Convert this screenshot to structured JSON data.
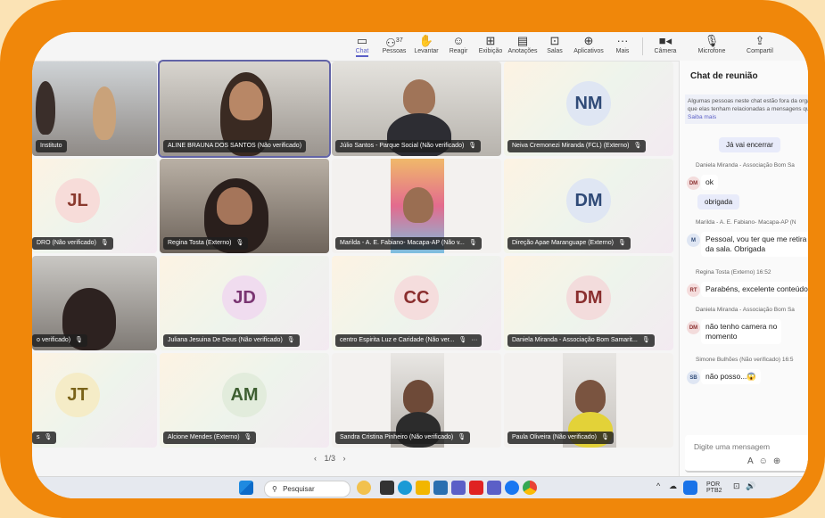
{
  "toolbar": {
    "items": [
      {
        "label": "Chat",
        "icon": "chat-icon"
      },
      {
        "label": "Pessoas",
        "icon": "people-icon",
        "count": "37"
      },
      {
        "label": "Levantar",
        "icon": "raise-hand-icon"
      },
      {
        "label": "Reagir",
        "icon": "react-icon"
      },
      {
        "label": "Exibição",
        "icon": "view-icon"
      },
      {
        "label": "Anotações",
        "icon": "notes-icon"
      },
      {
        "label": "Salas",
        "icon": "rooms-icon"
      },
      {
        "label": "Aplicativos",
        "icon": "apps-icon"
      },
      {
        "label": "Mais",
        "icon": "more-icon"
      },
      {
        "label": "Câmera",
        "icon": "camera-icon"
      },
      {
        "label": "Microfone",
        "icon": "mic-icon"
      },
      {
        "label": "Compartil",
        "icon": "share-icon"
      }
    ]
  },
  "tiles": [
    {
      "name": "Instituto",
      "type": "photo"
    },
    {
      "name": "ALINE BRAUNA DOS SANTOS (Não verificado)",
      "type": "photo"
    },
    {
      "name": "Júlio Santos - Parque Social (Não verificado)",
      "type": "photo"
    },
    {
      "name": "Neiva Cremonezi Miranda (FCL) (Externo)",
      "type": "avatar",
      "initials": "NM",
      "color": "#dfe6f3",
      "text": "#2f4a77"
    },
    {
      "name": "DRO (Não verificado)",
      "type": "avatar",
      "initials": "JL",
      "color": "#f7dcd9",
      "text": "#8a3a2e"
    },
    {
      "name": "Regina Tosta (Externo)",
      "type": "photo"
    },
    {
      "name": "Marilda - A. E. Fabiano- Macapa-AP (Não v...",
      "type": "photo"
    },
    {
      "name": "Direção Apae Maranguape (Externo)",
      "type": "avatar",
      "initials": "DM",
      "color": "#dfe6f3",
      "text": "#2f4a77"
    },
    {
      "name": "o verificado)",
      "type": "photo"
    },
    {
      "name": "Juliana Jesuina De Deus (Não verificado)",
      "type": "avatar",
      "initials": "JD",
      "color": "#f0dcef",
      "text": "#7a3572"
    },
    {
      "name": "centro Espirita Luz e Caridade (Não ver...",
      "type": "avatar",
      "initials": "CC",
      "color": "#f5dddd",
      "text": "#8a2e2e"
    },
    {
      "name": "Daniela Miranda - Associação Bom Samarit...",
      "type": "avatar",
      "initials": "DM",
      "color": "#f3dcdc",
      "text": "#8a2e2e"
    },
    {
      "name": "s",
      "type": "avatar",
      "initials": "JT",
      "color": "#f5ecc7",
      "text": "#7a6319"
    },
    {
      "name": "Alcione Mendes (Externo)",
      "type": "avatar",
      "initials": "AM",
      "color": "#e2ecdc",
      "text": "#3e5f31"
    },
    {
      "name": "Sandra Cristina Pinheiro (Não verificado)",
      "type": "photo"
    },
    {
      "name": "Paula Oliveira (Não verificado)",
      "type": "photo"
    }
  ],
  "pager": {
    "text": "1/3",
    "prev": "‹",
    "next": "›"
  },
  "chat": {
    "title": "Chat de reunião",
    "notice": "Algumas pessoas neste chat estão fora da organização. É possível que elas tenham relacionadas a mensagens que serão apl chat.",
    "notice_link": "Saiba mais",
    "messages": [
      {
        "kind": "mine",
        "text": "Já vai encerrar"
      },
      {
        "kind": "sender",
        "text": "Daniela Miranda - Associação Bom Sa"
      },
      {
        "kind": "other",
        "initials": "DM",
        "text": "ok"
      },
      {
        "kind": "mine",
        "text": "obrigada"
      },
      {
        "kind": "sender",
        "text": "Marilda - A. E. Fabiano- Macapa-AP (N"
      },
      {
        "kind": "other",
        "initials": "M",
        "text": "Pessoal, vou ter que me retira"
      },
      {
        "kind": "cont",
        "text": "da sala. Obrigada"
      },
      {
        "kind": "sender",
        "text": "Regina Tosta (Externo)  16:52"
      },
      {
        "kind": "other",
        "initials": "RT",
        "text": "Parabéns, excelente conteúdo"
      },
      {
        "kind": "sender",
        "text": "Daniela Miranda - Associação Bom Sa"
      },
      {
        "kind": "other",
        "initials": "DM",
        "text": "não tenho camera no"
      },
      {
        "kind": "cont",
        "text": "momento"
      },
      {
        "kind": "sender",
        "text": "Simone Bulhões (Não verificado)  16:5"
      },
      {
        "kind": "other",
        "initials": "SB",
        "text": "não posso...😱"
      }
    ],
    "compose_placeholder": "Digite uma mensagem"
  },
  "taskbar": {
    "search": "Pesquisar",
    "lang_top": "POR",
    "lang_bottom": "PTB2"
  }
}
